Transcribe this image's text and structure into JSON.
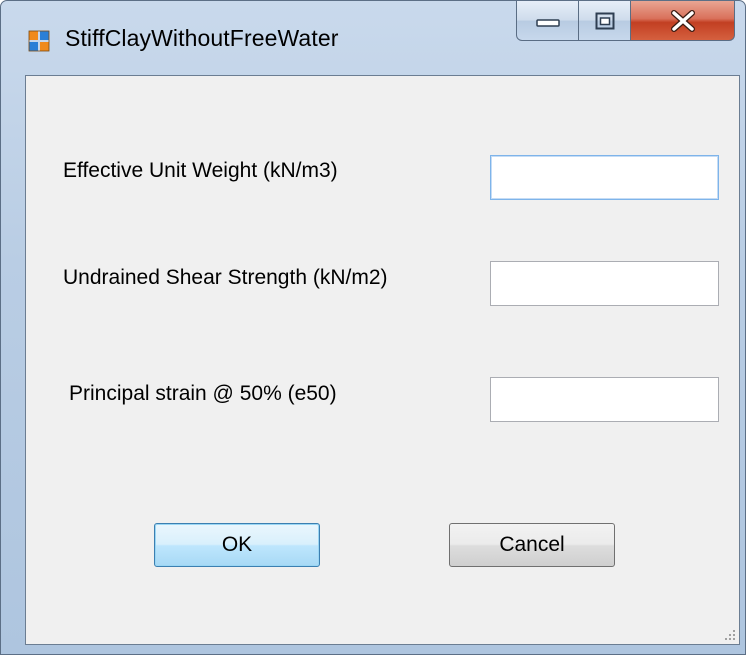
{
  "window": {
    "title": "StiffClayWithoutFreeWater",
    "icon": "form-app-icon",
    "caption_buttons": [
      "minimize-icon",
      "maximize-icon",
      "close-icon"
    ]
  },
  "form": {
    "fields": [
      {
        "label": "Effective Unit Weight (kN/m3)",
        "value": "",
        "placeholder": ""
      },
      {
        "label": "Undrained Shear Strength (kN/m2)",
        "value": "",
        "placeholder": ""
      },
      {
        "label": "Principal strain @ 50% (e50)",
        "value": "",
        "placeholder": ""
      }
    ],
    "ok_label": "OK",
    "cancel_label": "Cancel"
  },
  "colors": {
    "titlebar": "#b9cde4",
    "client": "#f0f0f0",
    "close_button": "#c94a2c",
    "default_button_border": "#3c7fb1"
  }
}
